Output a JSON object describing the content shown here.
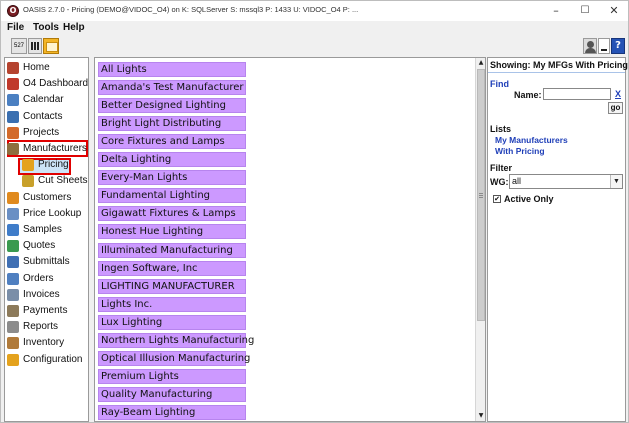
{
  "window": {
    "title": "OASIS 2.7.0 - Pricing (DEMO@VIDOC_O4) on K: SQLServer  S: mssql3  P: 1433  U: VIDOC_O4  P: ...",
    "controls": {
      "minimize": "–",
      "maximize": "☐",
      "close": "✕"
    }
  },
  "menu": {
    "file": "File",
    "tools": "Tools",
    "help": "Help"
  },
  "toolbar": {
    "calendar_num": "527",
    "help": "?"
  },
  "nav": {
    "items": [
      {
        "label": "Home",
        "icon": "home-icon",
        "color": "#b5432f"
      },
      {
        "label": "O4 Dashboard",
        "icon": "dashboard-icon",
        "color": "#c0392b"
      },
      {
        "label": "Calendar",
        "icon": "calendar-icon",
        "color": "#4a7fc1"
      },
      {
        "label": "Contacts",
        "icon": "contacts-icon",
        "color": "#3a6fb0"
      },
      {
        "label": "Projects",
        "icon": "projects-icon",
        "color": "#d36a2a"
      },
      {
        "label": "Manufacturers",
        "icon": "manufacturers-icon",
        "color": "#8d6e3f"
      },
      {
        "label": "Pricing",
        "icon": "pricing-icon",
        "color": "#e4a21d"
      },
      {
        "label": "Cut Sheets",
        "icon": "cut-sheets-icon",
        "color": "#c8a02a"
      },
      {
        "label": "Customers",
        "icon": "customers-icon",
        "color": "#e08a1e"
      },
      {
        "label": "Price Lookup",
        "icon": "price-lookup-icon",
        "color": "#6a8fc4"
      },
      {
        "label": "Samples",
        "icon": "samples-icon",
        "color": "#3f7cc9"
      },
      {
        "label": "Quotes",
        "icon": "quotes-icon",
        "color": "#3a9a4f"
      },
      {
        "label": "Submittals",
        "icon": "submittals-icon",
        "color": "#3f6fb3"
      },
      {
        "label": "Orders",
        "icon": "orders-icon",
        "color": "#4f7fc0"
      },
      {
        "label": "Invoices",
        "icon": "invoices-icon",
        "color": "#7a8ea8"
      },
      {
        "label": "Payments",
        "icon": "payments-icon",
        "color": "#8c7a5a"
      },
      {
        "label": "Reports",
        "icon": "reports-icon",
        "color": "#8c8c8c"
      },
      {
        "label": "Inventory",
        "icon": "inventory-icon",
        "color": "#b07a3a"
      },
      {
        "label": "Configuration",
        "icon": "configuration-icon",
        "color": "#e4a21d"
      }
    ]
  },
  "manufacturers": [
    "All Lights",
    "Amanda's Test Manufacturer",
    "Better Designed Lighting",
    "Bright Light Distributing",
    "Core Fixtures and Lamps",
    "Delta Lighting",
    "Every-Man Lights",
    "Fundamental Lighting",
    "Gigawatt Fixtures & Lamps",
    "Honest Hue Lighting",
    "Illuminated Manufacturing",
    "Ingen Software, Inc",
    "LIGHTING MANUFACTURER",
    "Lights Inc.",
    "Lux Lighting",
    "Northern Lights Manufacturing",
    "Optical Illusion Manufacturing",
    "Premium Lights",
    "Quality Manufacturing",
    "Ray-Beam Lighting"
  ],
  "scroll": {
    "up": "▲",
    "down": "▼"
  },
  "right": {
    "showing": "Showing: My MFGs With Pricing",
    "find_heading": "Find",
    "name_label": "Name:",
    "name_value": "",
    "clear": "X",
    "go": "go",
    "lists_heading": "Lists",
    "link_my_mfg": "My Manufacturers",
    "link_with_pricing": "With Pricing",
    "filter_heading": "Filter",
    "wg_label": "WG:",
    "wg_value": "all",
    "wg_arrow": "▼",
    "active_check": "✔",
    "active_label": "Active Only"
  },
  "colors": {
    "list_item_bg": "#cc99ff",
    "link": "#1f3fb8",
    "selection_outline": "#e00000"
  }
}
